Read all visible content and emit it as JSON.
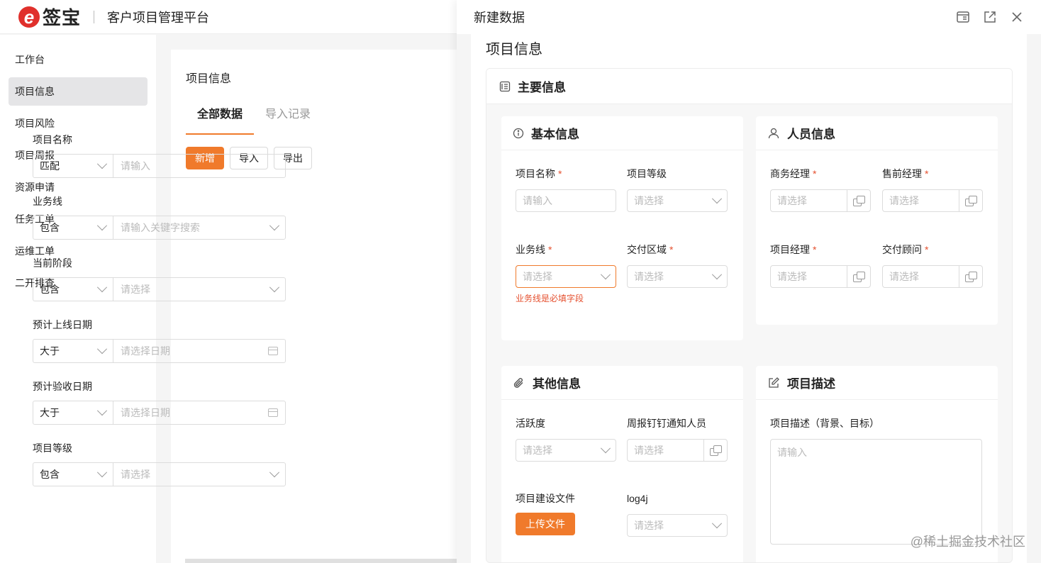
{
  "brand": {
    "logo_letter": "e",
    "logo_text": "签宝",
    "platform": "客户项目管理平台",
    "accent": "#f07a2b"
  },
  "sidebar": {
    "items": [
      {
        "label": "工作台"
      },
      {
        "label": "项目信息"
      },
      {
        "label": "项目风险"
      },
      {
        "label": "项目周报"
      },
      {
        "label": "资源申请"
      },
      {
        "label": "任务工单"
      },
      {
        "label": "运维工单"
      },
      {
        "label": "二开排查"
      }
    ]
  },
  "main": {
    "title": "项目信息",
    "tabs": [
      {
        "label": "全部数据"
      },
      {
        "label": "导入记录"
      }
    ],
    "buttons": {
      "add": "新增",
      "import": "导入",
      "export": "导出"
    },
    "filters": [
      {
        "label": "项目名称",
        "op": "匹配",
        "placeholder": "请输入"
      },
      {
        "label": "业务线",
        "op": "包含",
        "placeholder": "请输入关键字搜索"
      },
      {
        "label": "当前阶段",
        "op": "包含",
        "placeholder": "请选择"
      },
      {
        "label": "预计上线日期",
        "op": "大于",
        "placeholder": "请选择日期"
      },
      {
        "label": "预计验收日期",
        "op": "大于",
        "placeholder": "请选择日期"
      },
      {
        "label": "项目等级",
        "op": "包含",
        "placeholder": "请选择"
      }
    ]
  },
  "drawer": {
    "title": "新建数据",
    "section_title": "项目信息",
    "main_card_title": "主要信息",
    "basic": {
      "title": "基本信息",
      "fields": {
        "name": {
          "label": "项目名称",
          "placeholder": "请输入"
        },
        "level": {
          "label": "项目等级",
          "placeholder": "请选择"
        },
        "biz": {
          "label": "业务线",
          "placeholder": "请选择",
          "error": "业务线是必填字段"
        },
        "region": {
          "label": "交付区域",
          "placeholder": "请选择"
        }
      }
    },
    "people": {
      "title": "人员信息",
      "fields": {
        "bm": {
          "label": "商务经理",
          "placeholder": "请选择"
        },
        "pre": {
          "label": "售前经理",
          "placeholder": "请选择"
        },
        "pm": {
          "label": "项目经理",
          "placeholder": "请选择"
        },
        "adv": {
          "label": "交付顾问",
          "placeholder": "请选择"
        }
      }
    },
    "other": {
      "title": "其他信息",
      "fields": {
        "active": {
          "label": "活跃度",
          "placeholder": "请选择"
        },
        "notify": {
          "label": "周报钉钉通知人员",
          "placeholder": "请选择"
        },
        "file": {
          "label": "项目建设文件",
          "button": "上传文件"
        },
        "log": {
          "label": "log4j",
          "placeholder": "请选择"
        }
      }
    },
    "desc": {
      "title": "项目描述",
      "label": "项目描述（背景、目标）",
      "placeholder": "请输入"
    },
    "required_mark": "*"
  },
  "watermark": "@稀土掘金技术社区"
}
